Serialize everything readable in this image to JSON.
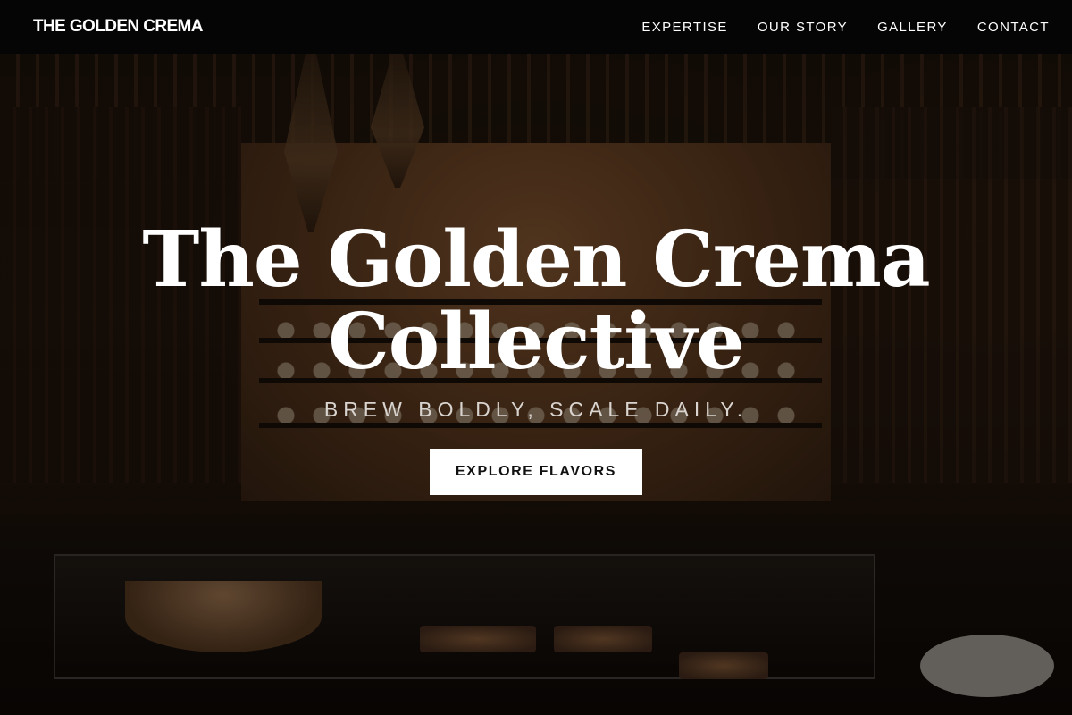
{
  "nav": {
    "brand": "THE GOLDEN CREMA",
    "links": [
      {
        "label": "EXPERTISE"
      },
      {
        "label": "OUR STORY"
      },
      {
        "label": "GALLERY"
      },
      {
        "label": "CONTACT"
      }
    ]
  },
  "hero": {
    "title": "The Golden Crema Collective",
    "tagline": "BREW BOLDLY, SCALE DAILY.",
    "cta_label": "EXPLORE FLAVORS"
  },
  "colors": {
    "nav_background": "#050505",
    "cta_background": "#ffffff",
    "text_primary": "#ffffff"
  }
}
